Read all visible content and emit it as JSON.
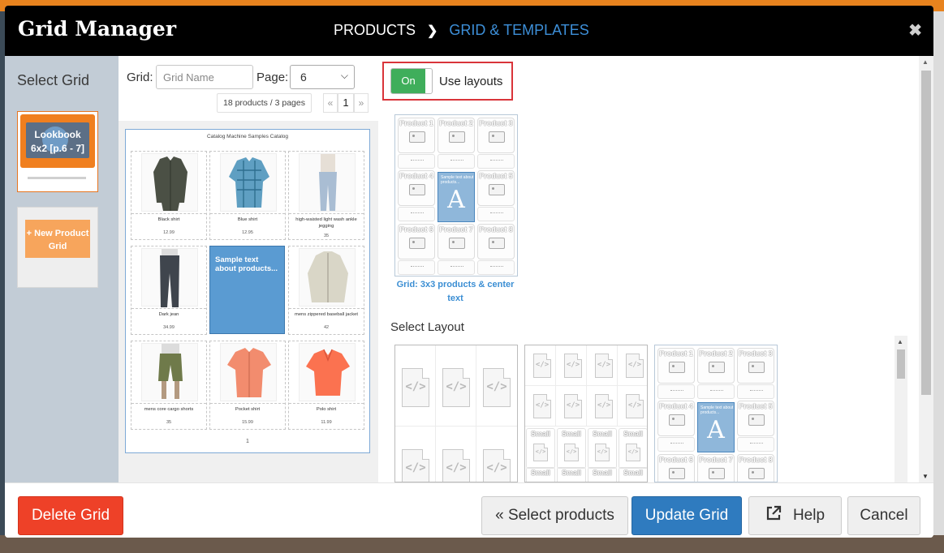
{
  "header": {
    "title": "Grid Manager",
    "breadcrumb_1": "PRODUCTS",
    "breadcrumb_sep": "❯",
    "breadcrumb_2": "GRID & TEMPLATES",
    "close": "✖"
  },
  "sidebar": {
    "title": "Select Grid",
    "grids": [
      {
        "label_line1": "Lookbook",
        "label_line2": "6x2 [p.6 - 7]"
      }
    ],
    "new_grid": {
      "line1": "+ New Product",
      "line2": "Grid"
    }
  },
  "toolbar": {
    "grid_label": "Grid:",
    "grid_name_placeholder": "Grid Name",
    "page_label": "Page:",
    "page_value": "6",
    "count_text": "18 products / 3 pages",
    "pager_prev": "«",
    "pager_current": "1",
    "pager_next": "»"
  },
  "preview": {
    "catalog_title": "Catalog Machine Samples Catalog",
    "products": [
      {
        "name": "Black shirt",
        "price": "12.99"
      },
      {
        "name": "Blue shirt",
        "price": "12.95"
      },
      {
        "name": "high-waisted light wash ankle jegging",
        "price": "35"
      },
      {
        "name": "Dark jean",
        "price": "34.99"
      },
      {
        "name": "mens zippered baseball jacket",
        "price": "42"
      },
      {
        "name": "mens core cargo shorts",
        "price": "35"
      },
      {
        "name": "Pocket shirt",
        "price": "15.99"
      },
      {
        "name": "Polo shirt",
        "price": "11.99"
      }
    ],
    "sample_text": "Sample text about products...",
    "page_number": "1"
  },
  "layouts": {
    "toggle_state": "On",
    "toggle_label": "Use layouts",
    "current_caption": "Grid: 3x3 products & center text",
    "select_layout_label": "Select Layout",
    "product_labels": [
      "Product 1",
      "Product 2",
      "Product 3",
      "Product 4",
      "Product 5",
      "Product 6",
      "Product 7",
      "Product 8"
    ],
    "small_label": "Small",
    "mini_center_text": "Sample text about products...",
    "center_letter": "A"
  },
  "footer": {
    "delete": "Delete Grid",
    "select_products": "« Select products",
    "update": "Update Grid",
    "help": "Help",
    "cancel": "Cancel"
  },
  "colors": {
    "header_bg": "#000000",
    "accent_blue": "#3d8fd8",
    "selected_orange": "#f07f1f",
    "danger": "#ee4128",
    "primary": "#2f7bbf",
    "toggle_green": "#3fae5b",
    "highlight_red": "#d9343a"
  }
}
